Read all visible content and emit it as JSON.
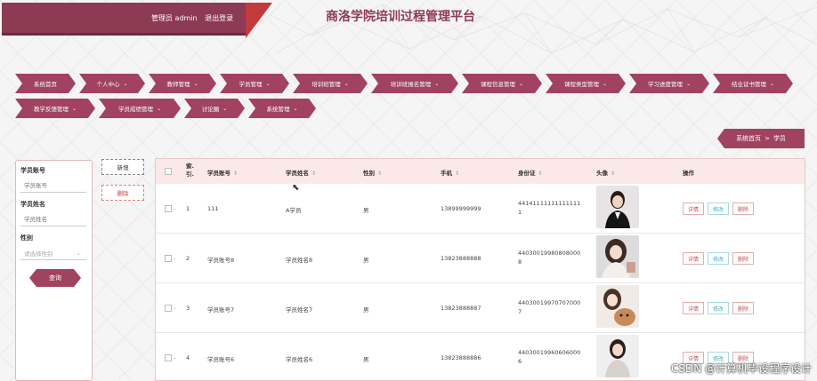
{
  "header": {
    "user_label": "管理员 admin",
    "logout": "退出登录",
    "title": "商洛学院培训过程管理平台"
  },
  "nav": {
    "items": [
      {
        "label": "系统首页",
        "chev": ""
      },
      {
        "label": "个人中心",
        "chev": "⌄"
      },
      {
        "label": "教师管理",
        "chev": "⌄"
      },
      {
        "label": "学员管理",
        "chev": "⌄"
      },
      {
        "label": "培训班管理",
        "chev": "⌄"
      },
      {
        "label": "培训班报名管理",
        "chev": "⌄"
      },
      {
        "label": "课程信息管理",
        "chev": "⌄"
      },
      {
        "label": "课程类型管理",
        "chev": "⌄"
      },
      {
        "label": "学习进度管理",
        "chev": "⌄"
      },
      {
        "label": "结业证书管理",
        "chev": "⌄"
      },
      {
        "label": "教学反馈管理",
        "chev": "⌄"
      },
      {
        "label": "学员成绩管理",
        "chev": "⌄"
      },
      {
        "label": "讨论圈",
        "chev": "⌄"
      },
      {
        "label": "系统管理",
        "chev": "⌄"
      }
    ]
  },
  "breadcrumb": {
    "home": "系统首页",
    "sep": ">",
    "current": "学员"
  },
  "search": {
    "account_label": "学员账号",
    "account_placeholder": "学员账号",
    "name_label": "学员姓名",
    "name_placeholder": "学员姓名",
    "gender_label": "性别",
    "gender_placeholder": "请选择性别",
    "query_button": "查询"
  },
  "actions": {
    "add": "新增",
    "delete": "删除"
  },
  "table": {
    "headers": {
      "index_line1": "索",
      "index_line2": "引",
      "account": "学员账号",
      "name": "学员姓名",
      "gender": "性别",
      "phone": "手机",
      "idcard": "身份证",
      "avatar": "头像",
      "ops": "操作"
    },
    "sort_glyph": "⇕",
    "rows": [
      {
        "index": "1",
        "account": "111",
        "name": "A学员",
        "gender": "男",
        "phone": "13899999999",
        "idcard": "441411111111111111"
      },
      {
        "index": "2",
        "account": "学员账号8",
        "name": "学员姓名8",
        "gender": "男",
        "phone": "13823888888",
        "idcard": "440300199808080008"
      },
      {
        "index": "3",
        "account": "学员账号7",
        "name": "学员姓名7",
        "gender": "男",
        "phone": "13823888887",
        "idcard": "440300199707070007"
      },
      {
        "index": "4",
        "account": "学员账号6",
        "name": "学员姓名6",
        "gender": "男",
        "phone": "13823888886",
        "idcard": "440300199606060006"
      }
    ],
    "op_detail": "详情",
    "op_edit": "修改",
    "op_delete": "删除"
  },
  "watermark": "CSDN @计算机毕设程序设计",
  "colors": {
    "brand": "#a04260",
    "header": "#8d3a55",
    "accent": "#c23a3a"
  }
}
